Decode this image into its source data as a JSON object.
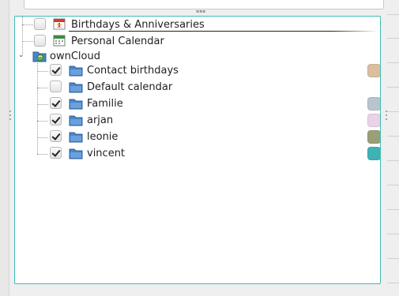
{
  "tree": {
    "items": [
      {
        "label": "Birthdays & Anniversaries",
        "checked": false,
        "icon": "birthday-calendar-icon"
      },
      {
        "label": "Personal Calendar",
        "checked": false,
        "icon": "calendar-icon"
      },
      {
        "label": "ownCloud",
        "icon": "owncloud-folder-icon",
        "expanded": true,
        "children": [
          {
            "label": "Contact birthdays",
            "checked": true,
            "icon": "folder-icon",
            "color": "#d9bf9f"
          },
          {
            "label": "Default calendar",
            "checked": false,
            "icon": "folder-icon",
            "color": null
          },
          {
            "label": "Familie",
            "checked": true,
            "icon": "folder-icon",
            "color": "#b9c4cf"
          },
          {
            "label": "arjan",
            "checked": true,
            "icon": "folder-icon",
            "color": "#ead2e8"
          },
          {
            "label": "leonie",
            "checked": true,
            "icon": "folder-icon",
            "color": "#9a9f79"
          },
          {
            "label": "vincent",
            "checked": true,
            "icon": "folder-icon",
            "color": "#3fb2b6"
          }
        ]
      }
    ]
  },
  "colors": {
    "focus_border": "#3fbcb4",
    "folder_blue": "#4a86c8"
  }
}
